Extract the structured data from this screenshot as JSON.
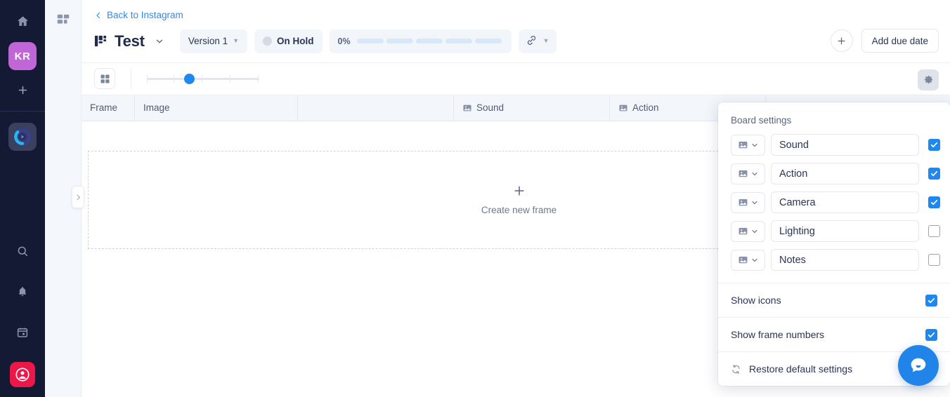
{
  "rail": {
    "home_icon": "home-icon",
    "workspace_initials": "KR",
    "add_icon": "plus-icon",
    "board_logo_icon": "play-circle-logo-icon",
    "search_icon": "search-icon",
    "notifications_icon": "bell-icon",
    "calendar_icon": "calendar-icon",
    "profile_icon": "user-avatar-icon"
  },
  "rail2": {
    "grid_icon": "grid-boards-icon",
    "expand_icon": "chevron-right-icon"
  },
  "header": {
    "back_label": "Back to Instagram",
    "back_icon": "chevron-left-icon",
    "board_icon": "storyboard-icon",
    "title": "Test",
    "title_caret": "chevron-down-icon",
    "version_label": "Version 1",
    "status_label": "On Hold",
    "progress_percent": "0%",
    "progress_segments": 5,
    "progress_filled": 0,
    "link_icon": "link-icon",
    "add_button_icon": "plus-icon",
    "due_date_label": "Add due date"
  },
  "toolbar": {
    "layout_icon": "grid-layout-icon",
    "zoom_value": 2,
    "zoom_ticks": 5,
    "settings_icon": "gear-icon"
  },
  "table": {
    "columns": [
      {
        "label": "Frame",
        "icon": null
      },
      {
        "label": "Image",
        "icon": null
      },
      {
        "label": "",
        "icon": null
      },
      {
        "label": "Sound",
        "icon": "image-icon"
      },
      {
        "label": "Action",
        "icon": "image-icon"
      },
      {
        "label": "",
        "icon": null
      }
    ],
    "empty_state": {
      "icon": "plus-icon",
      "label": "Create new frame"
    }
  },
  "settings_panel": {
    "title": "Board settings",
    "fields": [
      {
        "name": "Sound",
        "icon": "image-icon",
        "checked": true
      },
      {
        "name": "Action",
        "icon": "image-icon",
        "checked": true
      },
      {
        "name": "Camera",
        "icon": "image-icon",
        "checked": true
      },
      {
        "name": "Lighting",
        "icon": "image-icon",
        "checked": false
      },
      {
        "name": "Notes",
        "icon": "image-icon",
        "checked": false
      }
    ],
    "toggles": [
      {
        "label": "Show icons",
        "checked": true
      },
      {
        "label": "Show frame numbers",
        "checked": true
      }
    ],
    "restore_label": "Restore default settings",
    "restore_icon": "refresh-icon"
  },
  "chat": {
    "icon": "chat-bubble-icon"
  },
  "colors": {
    "accent": "#1e88f0",
    "link": "#2d8cf0",
    "rail_bg": "#141a33",
    "avatar": "#c066d6",
    "profile": "#eb1749",
    "table_head": "#f3f7fc"
  }
}
